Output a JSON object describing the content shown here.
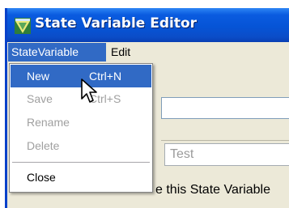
{
  "window": {
    "title": "State Variable Editor",
    "icon": "state-variable-editor-icon"
  },
  "menubar": {
    "items": [
      {
        "label": "StateVariable",
        "state": "open"
      },
      {
        "label": "Edit"
      }
    ]
  },
  "dropdown": {
    "items": [
      {
        "label": "New",
        "shortcut": "Ctrl+N",
        "enabled": true,
        "highlighted": true
      },
      {
        "label": "Save",
        "shortcut": "Ctrl+S",
        "enabled": false
      },
      {
        "label": "Rename",
        "enabled": false
      },
      {
        "label": "Delete",
        "enabled": false
      },
      {
        "label": "Close",
        "enabled": true
      }
    ]
  },
  "form": {
    "test_value": "Test",
    "description_fragment": "e this State Variable"
  },
  "colors": {
    "title_bar": "#0654d6",
    "highlight": "#316ac5",
    "disabled_text": "#a0a0a0"
  },
  "cursor": {
    "icon": "arrow-pointer-icon"
  }
}
